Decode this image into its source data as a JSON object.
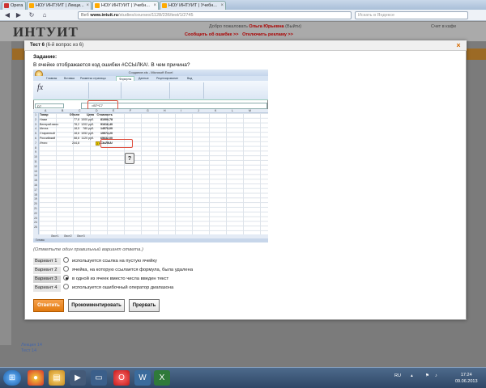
{
  "browser": {
    "tabs": [
      {
        "label": "Opera"
      },
      {
        "label": "НОУ ИНТУИТ | Лекци..."
      },
      {
        "label": "НОУ ИНТУИТ | Учебн..."
      },
      {
        "label": "НОУ ИНТУИТ | Учебн..."
      }
    ],
    "web_label": "Веб",
    "url_host": "www.intuit.ru",
    "url_path": "/studies/courses/1128/236/test/1/2745",
    "search_placeholder": "Искать в Яндексе"
  },
  "site": {
    "logo": "ИНТУИТ",
    "welcome_prefix": "Добро пожаловать",
    "user_name": "Ольга Юрьевна",
    "exit_label": "(Выйти)",
    "exit_links": "Счет в кафе",
    "report_error": "Сообщить об ошибке >>",
    "disable_ads": "Отключить рекламу >>",
    "footer_links": [
      "Лекция 14",
      "Тест 14"
    ]
  },
  "dialog": {
    "title": "Тест 6",
    "title_sub": "(6-й вопрос из 6)",
    "task_label": "Задание:",
    "question": "В ячейке отображается код ошибки #ССЫЛКА!. В чем причина?",
    "hint": "(Отметьте один правильный вариант ответа.)",
    "options": [
      {
        "label": "Вариант 1",
        "text": "используется ссылка на пустую ячейку",
        "selected": false
      },
      {
        "label": "Вариант 2",
        "text": "ячейка, на которую ссылается формула, была удалена",
        "selected": false
      },
      {
        "label": "Вариант 3",
        "text": "в одной из ячеек вместо числа введен текст",
        "selected": true
      },
      {
        "label": "Вариант 4",
        "text": "используется ошибочный оператор диапазона",
        "selected": false
      }
    ],
    "buttons": {
      "answer": "Ответить",
      "comment": "Прокомментировать",
      "abort": "Прервать"
    }
  },
  "excel": {
    "title": "Создание.xls - Microsoft Excel",
    "ribbon_tabs": [
      "Главная",
      "Вставка",
      "Разметка страницы",
      "Формулы",
      "Данные",
      "Рецензирование",
      "Вид"
    ],
    "name_box": "D7",
    "formula": "=B7*C7",
    "columns": [
      "A",
      "B",
      "C",
      "D",
      "E",
      "F",
      "G",
      "H",
      "I",
      "J",
      "K",
      "L",
      "M"
    ],
    "table": {
      "headers": [
        "Товар",
        "Объем",
        "Цена",
        "Стоимость"
      ],
      "rows": [
        [
          "Нами",
          "77,8",
          "1000 руб.",
          "81000,78"
        ],
        [
          "Венерий вино",
          "78,2",
          "1202 руб.",
          "91616,40"
        ],
        [
          "Мечта",
          "18,5",
          "780 руб.",
          "14570,00"
        ],
        [
          "Старинный",
          "18,6",
          "1052 руб.",
          "19573,20"
        ],
        [
          "Российский",
          "58,6",
          "1120 руб.",
          "65632,00"
        ],
        [
          "Итого",
          "244,8",
          "",
          "#ССЫЛКА!"
        ]
      ]
    },
    "sheet_tabs": [
      "Лист1",
      "Лист2",
      "Лист3"
    ],
    "status": "Готово"
  },
  "taskbar": {
    "lang": "RU",
    "time": "17:24",
    "date": "09.06.2013"
  },
  "colors": {
    "accent_orange": "#e27a10",
    "error_red": "#e05040",
    "site_band": "#9c6a25"
  }
}
